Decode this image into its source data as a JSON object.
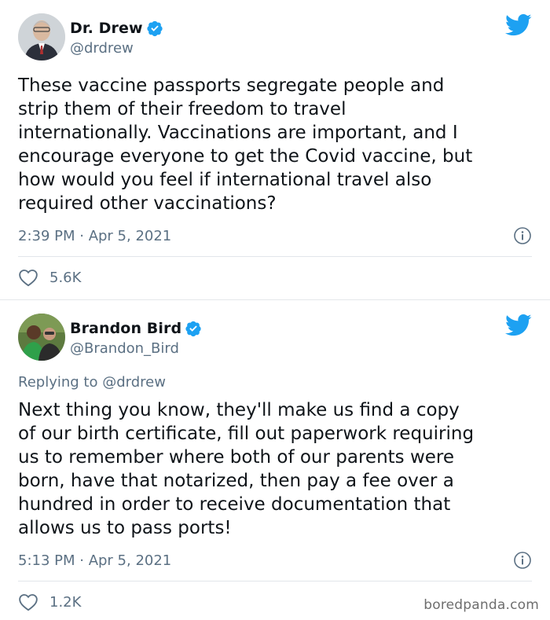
{
  "tweets": [
    {
      "author": {
        "name": "Dr. Drew",
        "handle": "@drdrew",
        "verified": true
      },
      "text": "These vaccine passports segregate people and\nstrip them of their freedom to travel\ninternationally. Vaccinations are important, and I\nencourage everyone to get the Covid vaccine, but\nhow would you feel if international travel also\nrequired other vaccinations?",
      "timestamp": "2:39 PM · Apr 5, 2021",
      "likes": "5.6K"
    },
    {
      "author": {
        "name": "Brandon Bird",
        "handle": "@Brandon_Bird",
        "verified": true
      },
      "replying_label": "Replying to",
      "replying_to": "@drdrew",
      "text": "Next thing you know, they'll make us find a copy\nof our birth certificate, fill out paperwork requiring\nus to remember where both of our parents were\nborn, have that notarized, then pay a fee over a\nhundred in order to receive documentation that\nallows us to pass ports!",
      "timestamp": "5:13 PM · Apr 5, 2021",
      "likes": "1.2K"
    }
  ],
  "watermark": "boredpanda.com",
  "colors": {
    "twitter_blue": "#1da1f2",
    "muted": "#5b7083",
    "text": "#0f1419"
  }
}
